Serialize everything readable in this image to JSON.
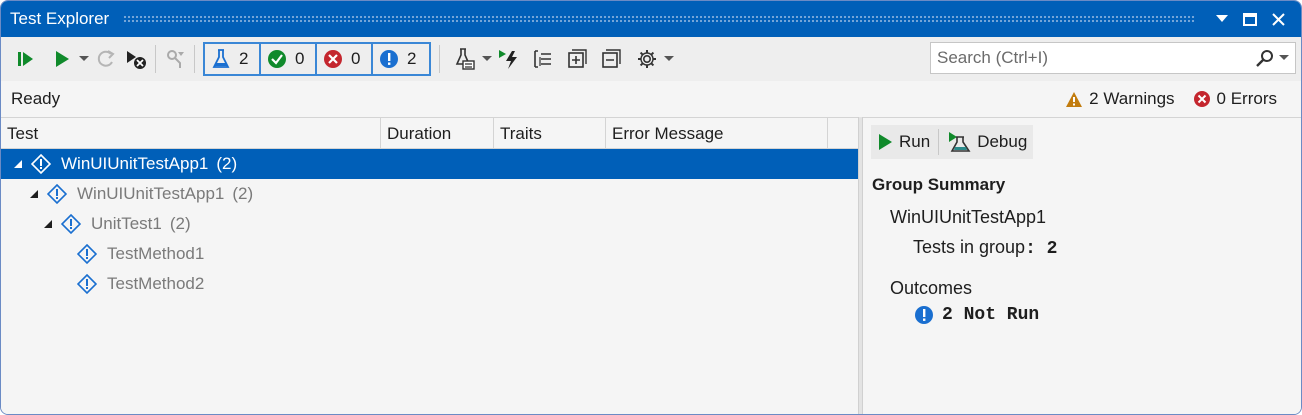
{
  "window": {
    "title": "Test Explorer"
  },
  "toolbar": {
    "chips": [
      {
        "icon": "flask-icon",
        "count": "2"
      },
      {
        "icon": "passed-icon",
        "count": "0"
      },
      {
        "icon": "failed-icon",
        "count": "0"
      },
      {
        "icon": "not-run-icon",
        "count": "2"
      }
    ],
    "search_placeholder": "Search (Ctrl+I)"
  },
  "status": {
    "text": "Ready",
    "warnings": "2 Warnings",
    "errors": "0 Errors"
  },
  "grid": {
    "columns": [
      "Test",
      "Duration",
      "Traits",
      "Error Message"
    ],
    "rows": [
      {
        "name": "WinUIUnitTestApp1",
        "count": "(2)"
      },
      {
        "name": "WinUIUnitTestApp1",
        "count": "(2)"
      },
      {
        "name": "UnitTest1",
        "count": "(2)"
      },
      {
        "name": "TestMethod1",
        "count": ""
      },
      {
        "name": "TestMethod2",
        "count": ""
      }
    ]
  },
  "detail": {
    "run_label": "Run",
    "debug_label": "Debug",
    "summary_title": "Group Summary",
    "group_name": "WinUIUnitTestApp1",
    "tests_in_group_label": "Tests in group",
    "tests_in_group_value": ": 2",
    "outcomes_label": "Outcomes",
    "not_run_text": "2 Not Run"
  },
  "colors": {
    "accent": "#005fb8",
    "not_run_blue": "#1a6fd0",
    "passed_green": "#108a2b",
    "failed_red": "#c4262e",
    "warning_orange": "#c27c0e"
  }
}
